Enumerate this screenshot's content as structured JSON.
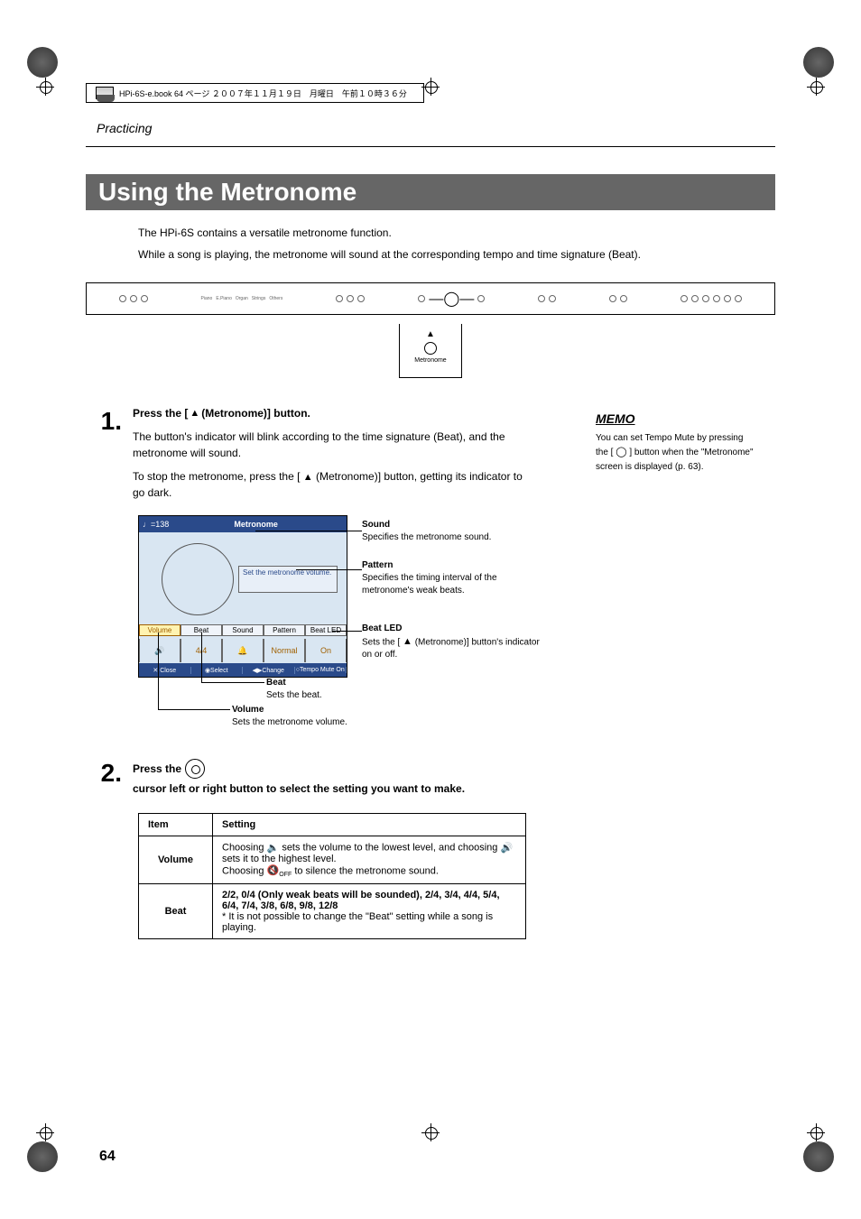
{
  "file_header": "HPi-6S-e.book  64 ページ  ２００７年１１月１９日　月曜日　午前１０時３６分",
  "running_header": "Practicing",
  "section_title": "Using the Metronome",
  "intro": {
    "line1": "The HPi-6S contains a versatile metronome function.",
    "line2": "While a song is playing, the metronome will sound at the corresponding tempo and time signature (Beat)."
  },
  "panel": {
    "metronome_label": "Metronome"
  },
  "step1": {
    "num": "1.",
    "title_pre": "Press the [",
    "title_post": " (Metronome)] button.",
    "body1": "The button's indicator will blink according to the time signature (Beat), and the metronome will sound.",
    "body2_pre": "To stop the metronome, press the [",
    "body2_post": " (Metronome)] button, getting its indicator to go dark."
  },
  "memo": {
    "label": "MEMO",
    "body_pre": "You can set Tempo Mute by pressing the [",
    "body_post": "] button when the \"Metronome\" screen is displayed (p. 63)."
  },
  "screen": {
    "tempo": "♩=138",
    "title": "Metronome",
    "popup": "Set the metronome volume.",
    "tabs": {
      "volume": "Volume",
      "beat": "Beat",
      "sound": "Sound",
      "pattern": "Pattern",
      "beat_led": "Beat LED"
    },
    "values": {
      "beat": "4/4",
      "pattern": "Normal",
      "beat_led": "On"
    },
    "footer": {
      "close": "✕ Close",
      "select": "◉Select",
      "change": "◀▶Change",
      "mute": "○Tempo Mute On"
    }
  },
  "callouts": {
    "sound": {
      "title": "Sound",
      "body": "Specifies the metronome sound."
    },
    "pattern": {
      "title": "Pattern",
      "body": "Specifies the timing interval of the metronome's weak beats."
    },
    "beat_led": {
      "title": "Beat LED",
      "body_pre": "Sets the [",
      "body_post": " (Metronome)] button's indicator on or off."
    },
    "beat": {
      "title": "Beat",
      "body": "Sets the beat."
    },
    "volume": {
      "title": "Volume",
      "body": "Sets the metronome volume."
    }
  },
  "step2": {
    "num": "2.",
    "title_pre": "Press the ",
    "title_post": " cursor left or right button to select the setting you want to make."
  },
  "table": {
    "headers": {
      "item": "Item",
      "setting": "Setting"
    },
    "rows": {
      "volume": {
        "label": "Volume",
        "line1_pre": "Choosing ",
        "line1_post": " sets the volume to the lowest level, and choosing ",
        "line2_post": " sets it to the highest level.",
        "line3_pre": "Choosing ",
        "line3_post": " to silence the metronome sound."
      },
      "beat": {
        "label": "Beat",
        "line1": "2/2, 0/4 (Only weak beats will be sounded), 2/4, 3/4, 4/4, 5/4, 6/4, 7/4, 3/8, 6/8, 9/8, 12/8",
        "line2": "* It is not possible to change the \"Beat\" setting while a song is playing."
      }
    }
  },
  "page_number": "64"
}
